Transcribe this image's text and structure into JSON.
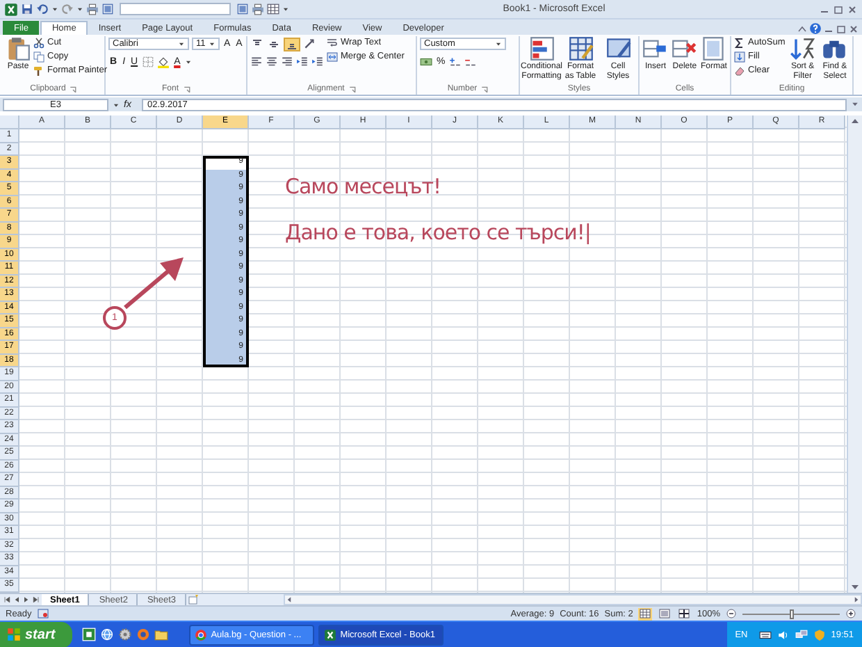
{
  "window": {
    "title": "Book1 - Microsoft Excel"
  },
  "tabs": [
    {
      "label": "File",
      "kind": "file",
      "selected": false
    },
    {
      "label": "Home",
      "kind": "tab",
      "selected": true
    },
    {
      "label": "Insert",
      "kind": "tab",
      "selected": false
    },
    {
      "label": "Page Layout",
      "kind": "tab",
      "selected": false
    },
    {
      "label": "Formulas",
      "kind": "tab",
      "selected": false
    },
    {
      "label": "Data",
      "kind": "tab",
      "selected": false
    },
    {
      "label": "Review",
      "kind": "tab",
      "selected": false
    },
    {
      "label": "View",
      "kind": "tab",
      "selected": false
    },
    {
      "label": "Developer",
      "kind": "tab",
      "selected": false
    }
  ],
  "ribbon": [
    {
      "label": "Clipboard",
      "kind": "clipboard",
      "large": [
        {
          "label": "Paste"
        }
      ],
      "small": [
        {
          "label": "Cut"
        },
        {
          "label": "Copy"
        },
        {
          "label": "Format Painter"
        }
      ]
    },
    {
      "label": "Font",
      "kind": "font",
      "combos": [
        {
          "value": "Calibri"
        },
        {
          "value": "11"
        }
      ],
      "grow_buttons": [
        "A",
        "A"
      ],
      "style_buttons": [
        "B",
        "I",
        "U"
      ],
      "color_button": "A"
    },
    {
      "label": "Alignment",
      "kind": "alignment",
      "align_buttons": [
        {
          "selected": false
        },
        {
          "selected": false
        },
        {
          "selected": true
        }
      ],
      "small": [
        {
          "label": "Wrap Text"
        },
        {
          "label": "Merge & Center"
        }
      ]
    },
    {
      "label": "Number",
      "kind": "number",
      "combos": [
        {
          "value": "Custom"
        }
      ],
      "glyphs": [
        "%"
      ]
    },
    {
      "label": "Styles",
      "kind": "styles",
      "large": [
        {
          "label": "Conditional Formatting"
        },
        {
          "label": "Format as Table"
        },
        {
          "label": "Cell Styles"
        }
      ]
    },
    {
      "label": "Cells",
      "kind": "cells",
      "large": [
        {
          "label": "Insert"
        },
        {
          "label": "Delete"
        },
        {
          "label": "Format"
        }
      ]
    },
    {
      "label": "Editing",
      "kind": "editing",
      "small": [
        {
          "label": "AutoSum"
        },
        {
          "label": "Fill"
        },
        {
          "label": "Clear"
        }
      ],
      "large": [
        {
          "label": "Sort & Filter"
        },
        {
          "label": "Find & Select"
        }
      ]
    }
  ],
  "formula_bar": {
    "name_box": "E3",
    "function_label": "fx",
    "formula": "02.9.2017"
  },
  "sheet": {
    "columns": [
      {
        "label": "A",
        "selected": false
      },
      {
        "label": "B",
        "selected": false
      },
      {
        "label": "C",
        "selected": false
      },
      {
        "label": "D",
        "selected": false
      },
      {
        "label": "E",
        "selected": true
      },
      {
        "label": "F",
        "selected": false
      },
      {
        "label": "G",
        "selected": false
      },
      {
        "label": "H",
        "selected": false
      },
      {
        "label": "I",
        "selected": false
      },
      {
        "label": "J",
        "selected": false
      },
      {
        "label": "K",
        "selected": false
      },
      {
        "label": "L",
        "selected": false
      },
      {
        "label": "M",
        "selected": false
      },
      {
        "label": "N",
        "selected": false
      },
      {
        "label": "O",
        "selected": false
      },
      {
        "label": "P",
        "selected": false
      },
      {
        "label": "Q",
        "selected": false
      },
      {
        "label": "R",
        "selected": false
      }
    ],
    "rows": [
      {
        "label": "1",
        "selected": false
      },
      {
        "label": "2",
        "selected": false
      },
      {
        "label": "3",
        "selected": true,
        "cells": [
          {},
          {},
          {},
          {},
          {
            "value": "9",
            "selected": true,
            "active": true
          }
        ]
      },
      {
        "label": "4",
        "selected": true,
        "cells": [
          {},
          {},
          {},
          {},
          {
            "value": "9",
            "selected": true,
            "active": false
          }
        ]
      },
      {
        "label": "5",
        "selected": true,
        "cells": [
          {},
          {},
          {},
          {},
          {
            "value": "9",
            "selected": true,
            "active": false
          }
        ]
      },
      {
        "label": "6",
        "selected": true,
        "cells": [
          {},
          {},
          {},
          {},
          {
            "value": "9",
            "selected": true,
            "active": false
          }
        ]
      },
      {
        "label": "7",
        "selected": true,
        "cells": [
          {},
          {},
          {},
          {},
          {
            "value": "9",
            "selected": true,
            "active": false
          }
        ]
      },
      {
        "label": "8",
        "selected": true,
        "cells": [
          {},
          {},
          {},
          {},
          {
            "value": "9",
            "selected": true,
            "active": false
          }
        ]
      },
      {
        "label": "9",
        "selected": true,
        "cells": [
          {},
          {},
          {},
          {},
          {
            "value": "9",
            "selected": true,
            "active": false
          }
        ]
      },
      {
        "label": "10",
        "selected": true,
        "cells": [
          {},
          {},
          {},
          {},
          {
            "value": "9",
            "selected": true,
            "active": false
          }
        ]
      },
      {
        "label": "11",
        "selected": true,
        "cells": [
          {},
          {},
          {},
          {},
          {
            "value": "9",
            "selected": true,
            "active": false
          }
        ]
      },
      {
        "label": "12",
        "selected": true,
        "cells": [
          {},
          {},
          {},
          {},
          {
            "value": "9",
            "selected": true,
            "active": false
          }
        ]
      },
      {
        "label": "13",
        "selected": true,
        "cells": [
          {},
          {},
          {},
          {},
          {
            "value": "9",
            "selected": true,
            "active": false
          }
        ]
      },
      {
        "label": "14",
        "selected": true,
        "cells": [
          {},
          {},
          {},
          {},
          {
            "value": "9",
            "selected": true,
            "active": false
          }
        ]
      },
      {
        "label": "15",
        "selected": true,
        "cells": [
          {},
          {},
          {},
          {},
          {
            "value": "9",
            "selected": true,
            "active": false
          }
        ]
      },
      {
        "label": "16",
        "selected": true,
        "cells": [
          {},
          {},
          {},
          {},
          {
            "value": "9",
            "selected": true,
            "active": false
          }
        ]
      },
      {
        "label": "17",
        "selected": true,
        "cells": [
          {},
          {},
          {},
          {},
          {
            "value": "9",
            "selected": true,
            "active": false
          }
        ]
      },
      {
        "label": "18",
        "selected": true,
        "cells": [
          {},
          {},
          {},
          {},
          {
            "value": "9",
            "selected": true,
            "active": false
          }
        ]
      },
      {
        "label": "19",
        "selected": false
      },
      {
        "label": "20",
        "selected": false
      },
      {
        "label": "21",
        "selected": false
      },
      {
        "label": "22",
        "selected": false
      },
      {
        "label": "23",
        "selected": false
      },
      {
        "label": "24",
        "selected": false
      },
      {
        "label": "25",
        "selected": false
      },
      {
        "label": "26",
        "selected": false
      },
      {
        "label": "27",
        "selected": false
      },
      {
        "label": "28",
        "selected": false
      },
      {
        "label": "29",
        "selected": false
      },
      {
        "label": "30",
        "selected": false
      },
      {
        "label": "31",
        "selected": false
      },
      {
        "label": "32",
        "selected": false
      },
      {
        "label": "33",
        "selected": false
      },
      {
        "label": "34",
        "selected": false
      },
      {
        "label": "35",
        "selected": false
      }
    ],
    "annotations": [
      {
        "text": "Само месецът!"
      },
      {
        "text": "Дано е това, което се търси!|"
      }
    ],
    "marker": {
      "label": "1"
    }
  },
  "sheet_tabs": [
    {
      "label": "Sheet1",
      "selected": true
    },
    {
      "label": "Sheet2",
      "selected": false
    },
    {
      "label": "Sheet3",
      "selected": false
    }
  ],
  "status_bar": {
    "mode": "Ready",
    "stats": [
      "Average: 9",
      "Count: 16",
      "Sum: 2"
    ],
    "views": [
      {
        "selected": true
      },
      {
        "selected": false
      },
      {
        "selected": false
      }
    ],
    "zoom": "100%",
    "zoom_slider": {
      "level": 0.5
    }
  },
  "taskbar": {
    "start": "start",
    "windows": [
      {
        "label": "Aula.bg - Question - ...",
        "selected": false
      },
      {
        "label": "Microsoft Excel - Book1",
        "selected": true
      }
    ],
    "language": "EN",
    "clock": "19:51"
  }
}
